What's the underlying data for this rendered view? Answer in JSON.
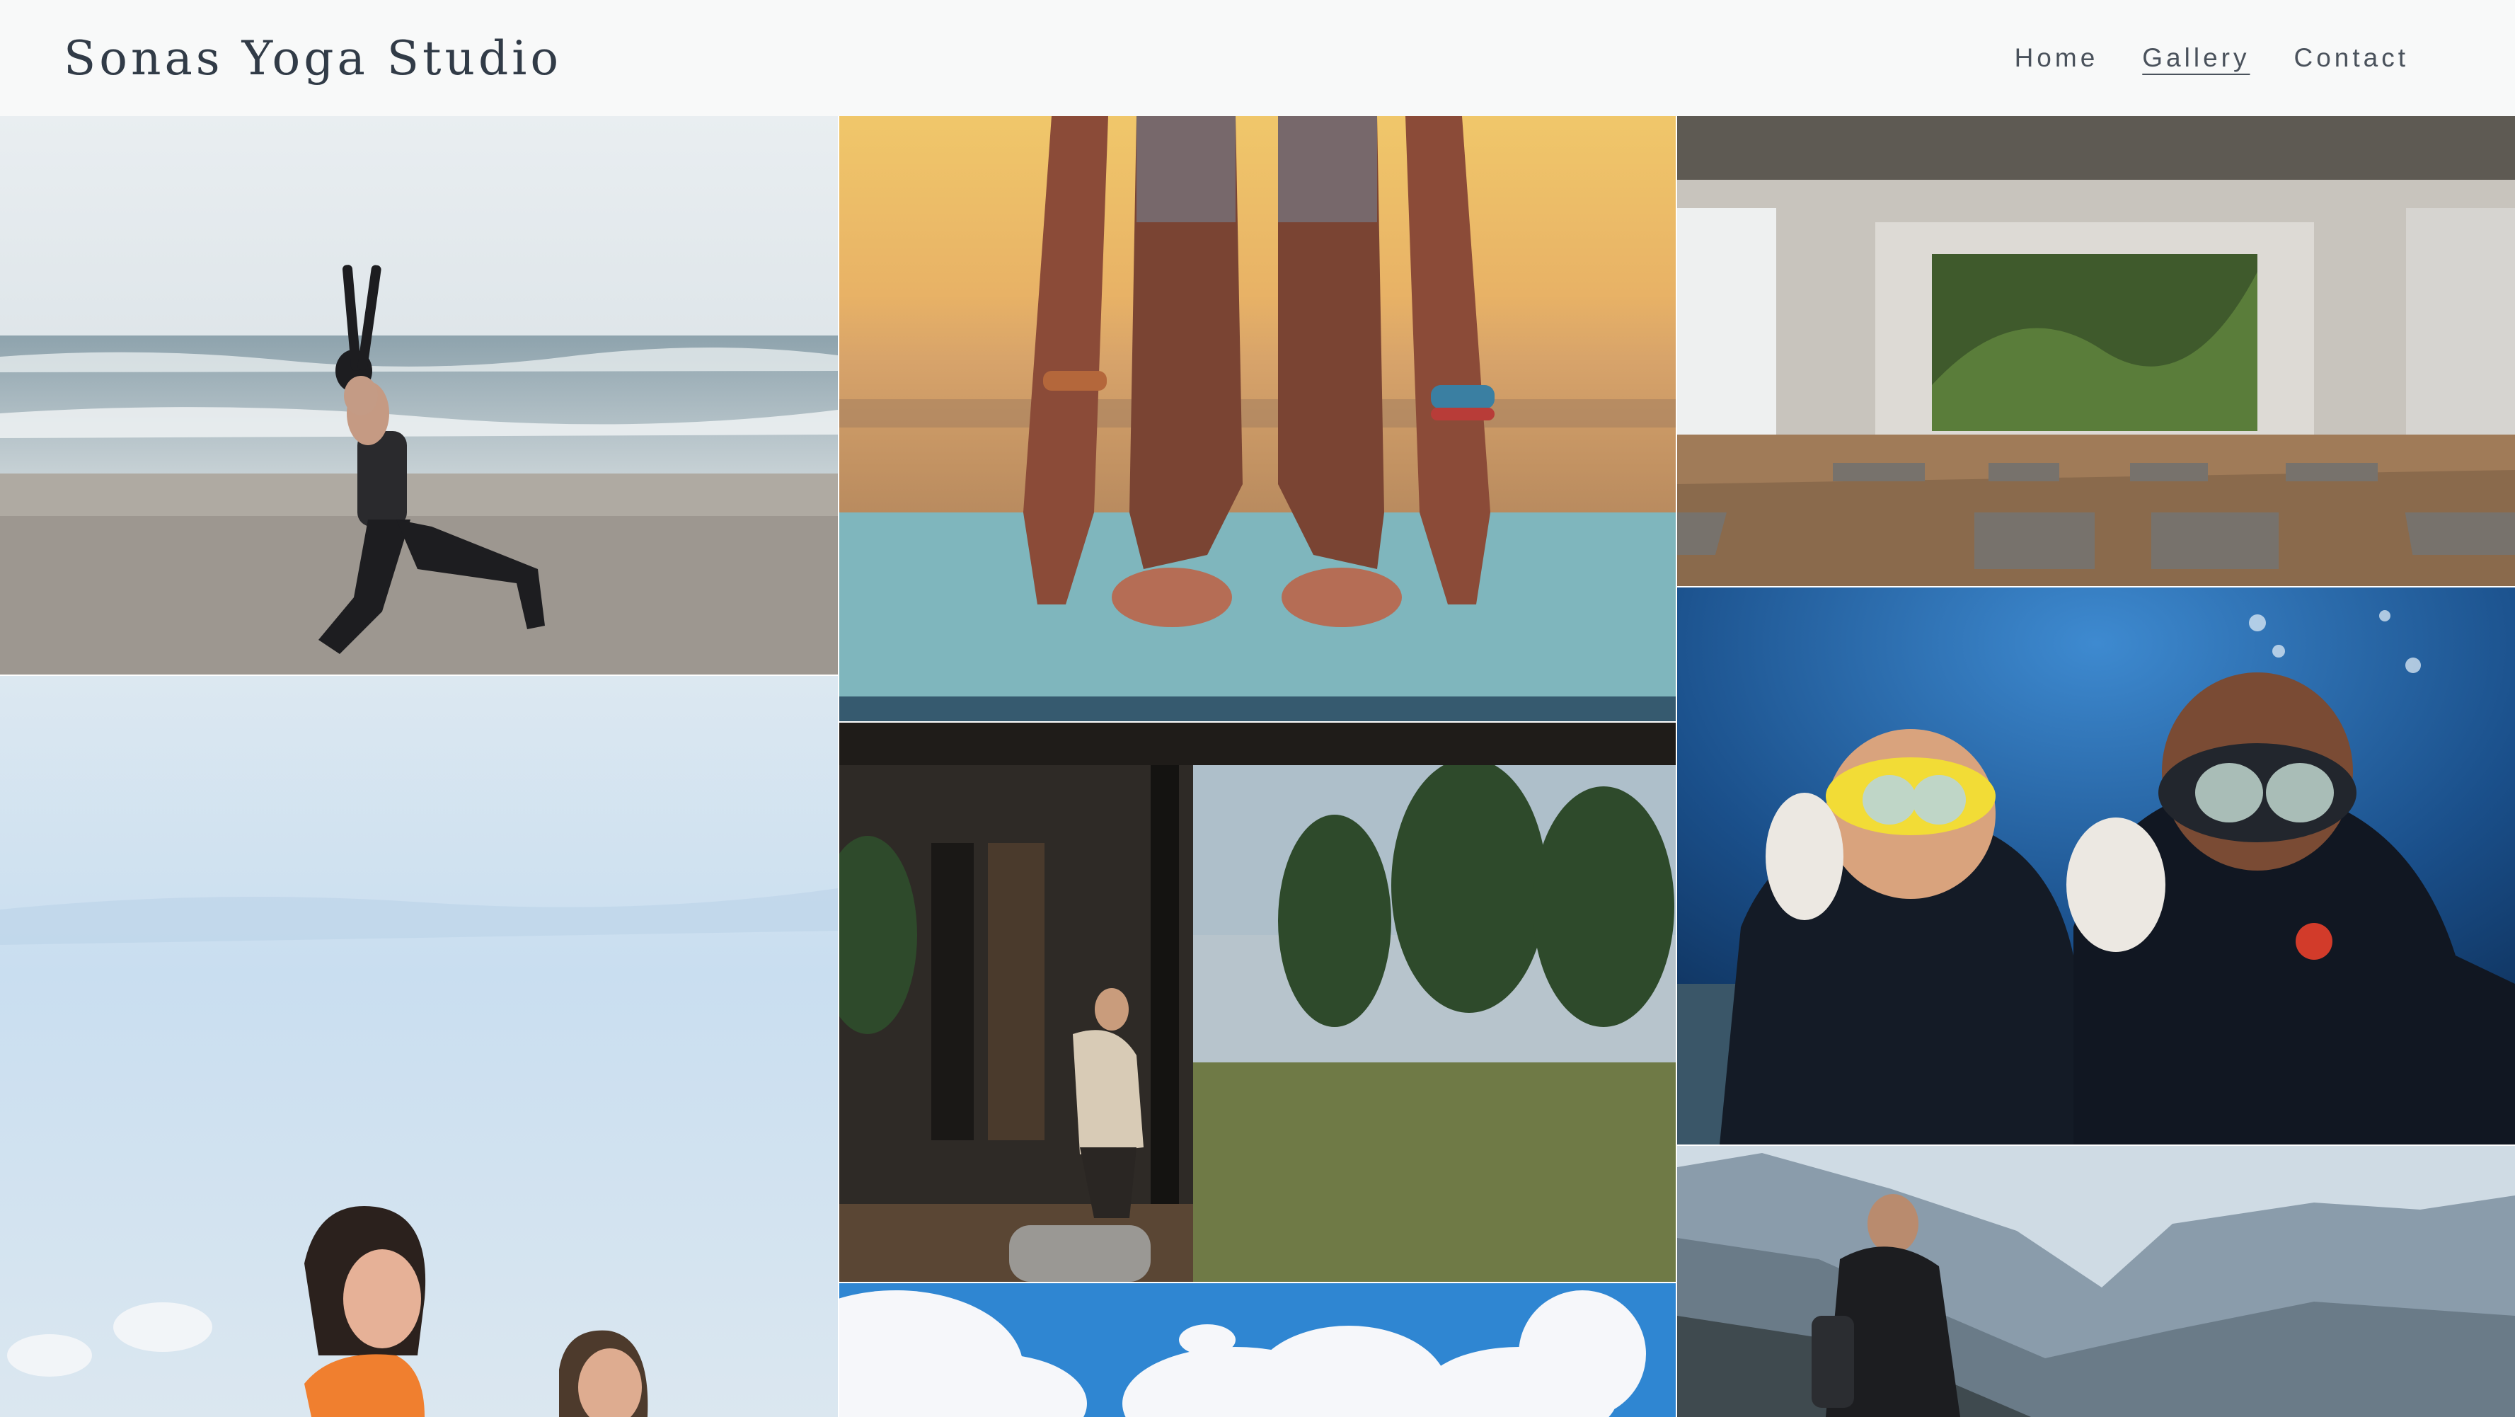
{
  "site": {
    "title": "Sonas Yoga Studio"
  },
  "nav": {
    "items": [
      {
        "label": "Home"
      },
      {
        "label": "Gallery",
        "active": true
      },
      {
        "label": "Contact"
      }
    ]
  },
  "gallery": {
    "photos": [
      {
        "subject": "woman-warrior-pose-beach"
      },
      {
        "subject": "forward-fold-feet-on-mat"
      },
      {
        "subject": "yoga-studio-room-green-wall"
      },
      {
        "subject": "two-women-sky"
      },
      {
        "subject": "woman-in-glass-cabin"
      },
      {
        "subject": "scuba-divers-ok-sign"
      },
      {
        "subject": "clouds-blue-sky"
      },
      {
        "subject": "hiker-mountains"
      }
    ]
  },
  "colors": {
    "header_bg": "#f8f9f9",
    "title": "#313b47",
    "nav_text": "#4a525c"
  }
}
